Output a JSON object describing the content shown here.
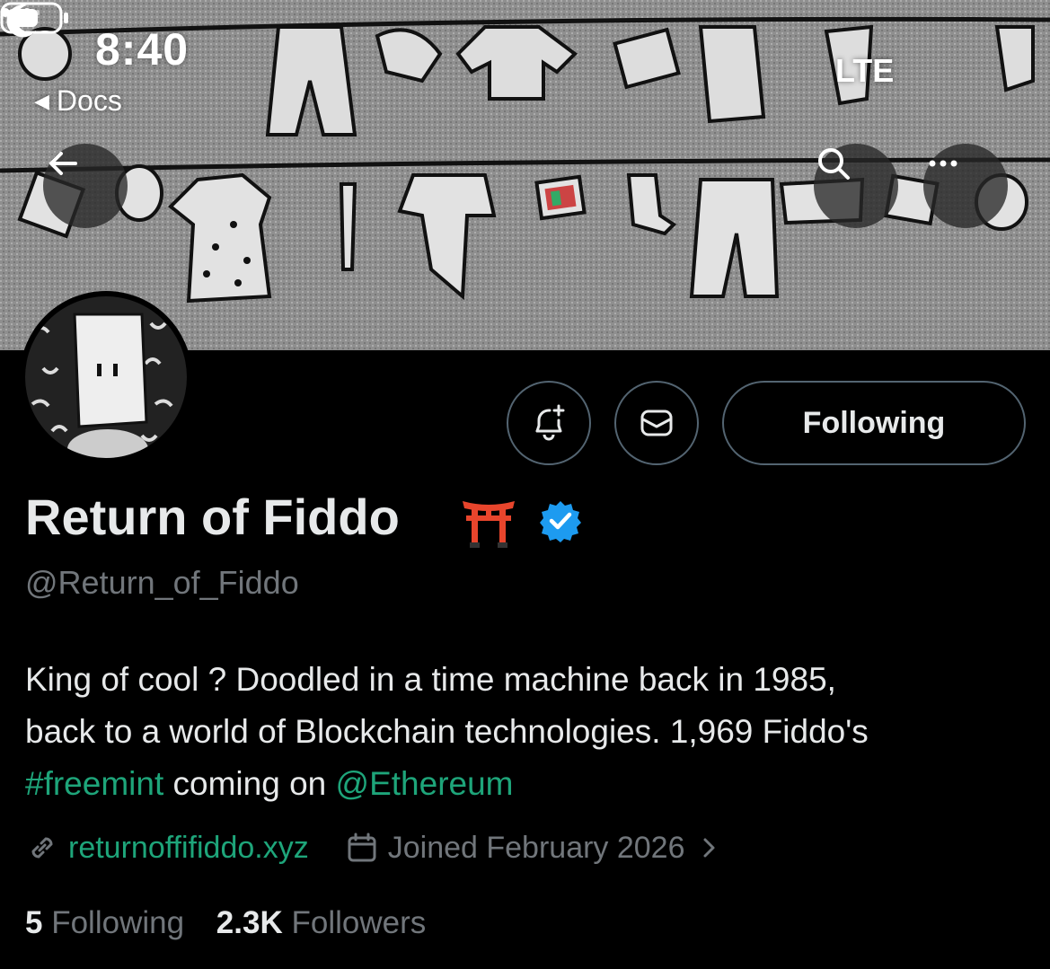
{
  "status_bar": {
    "time": "8:40",
    "back_app": "Docs",
    "network": "LTE"
  },
  "profile": {
    "display_name": "Return of Fiddo",
    "name_emoji": "torii-gate-emoji",
    "verified": true,
    "handle": "@Return_of_Fiddo",
    "bio": {
      "line1": "King of cool ? Doodled in a time machine back in 1985,",
      "line2": "back to a world of Blockchain technologies. 1,969 Fiddo's",
      "hashtag": "#freemint",
      "line3_mid": " coming on ",
      "mention": "@Ethereum"
    },
    "website": "returnoffifiddo.xyz",
    "joined": "Joined February 2026",
    "following_count": "5",
    "following_label": "Following",
    "followers_count": "2.3K",
    "followers_label": "Followers"
  },
  "actions": {
    "following_button": "Following",
    "notify_icon": "bell-plus-icon",
    "message_icon": "envelope-icon"
  },
  "colors": {
    "link": "#1ea57a",
    "muted": "#71767b",
    "verified": "#1d9bf0",
    "torii": "#e8452c"
  }
}
